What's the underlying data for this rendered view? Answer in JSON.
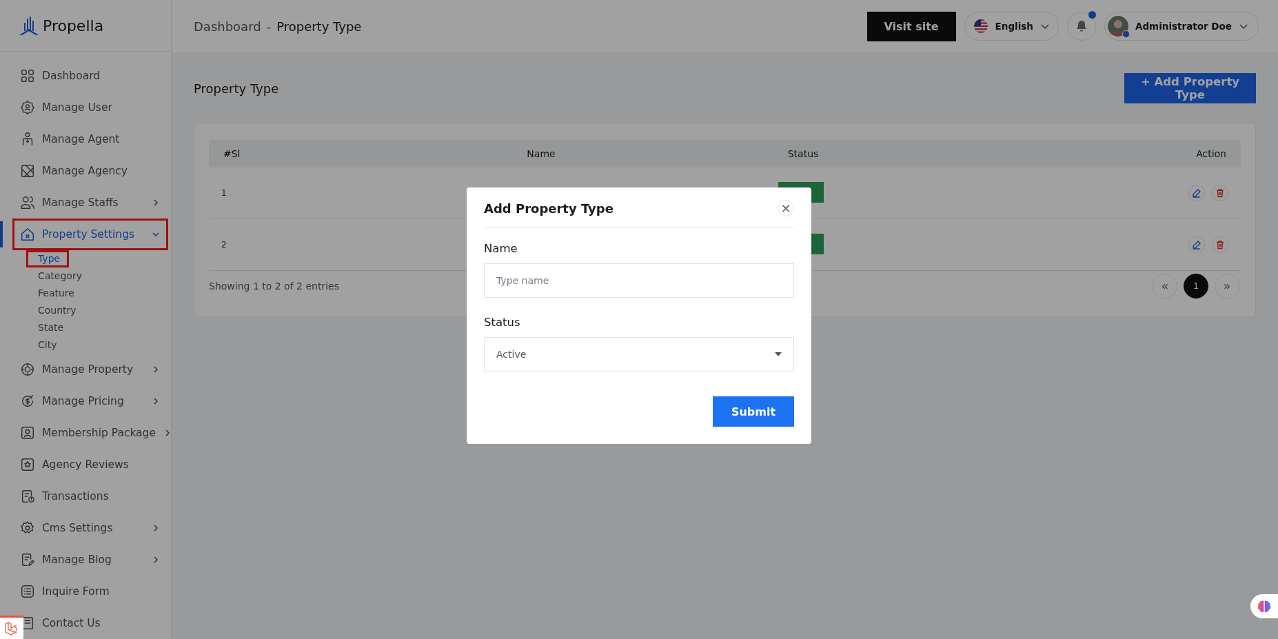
{
  "brand": {
    "name": "Propella"
  },
  "sidebar": {
    "items": [
      {
        "label": "Dashboard",
        "selected": false,
        "highlighted": false
      },
      {
        "label": "Manage User",
        "selected": false,
        "highlighted": false
      },
      {
        "label": "Manage Agent",
        "selected": false,
        "highlighted": false
      },
      {
        "label": "Manage Agency",
        "selected": false,
        "highlighted": false
      },
      {
        "label": "Manage Staffs",
        "selected": false,
        "highlighted": false,
        "expanded": false
      },
      {
        "label": "Property Settings",
        "selected": true,
        "highlighted": true,
        "expanded": true,
        "children": [
          {
            "label": "Type",
            "selected": true,
            "highlighted": true
          },
          {
            "label": "Category",
            "selected": false,
            "highlighted": false
          },
          {
            "label": "Feature",
            "selected": false,
            "highlighted": false
          },
          {
            "label": "Country",
            "selected": false,
            "highlighted": false
          },
          {
            "label": "State",
            "selected": false,
            "highlighted": false
          },
          {
            "label": "City",
            "selected": false,
            "highlighted": false
          }
        ]
      },
      {
        "label": "Manage Property",
        "selected": false,
        "highlighted": false,
        "expanded": false
      },
      {
        "label": "Manage Pricing",
        "selected": false,
        "highlighted": false,
        "expanded": false
      },
      {
        "label": "Membership Package",
        "selected": false,
        "highlighted": false,
        "expanded": false
      },
      {
        "label": "Agency Reviews",
        "selected": false,
        "highlighted": false
      },
      {
        "label": "Transactions",
        "selected": false,
        "highlighted": false
      },
      {
        "label": "Cms Settings",
        "selected": false,
        "highlighted": false,
        "expanded": false
      },
      {
        "label": "Manage Blog",
        "selected": false,
        "highlighted": false,
        "expanded": false
      },
      {
        "label": "Inquire Form",
        "selected": false,
        "highlighted": false
      },
      {
        "label": "Contact Us",
        "selected": false,
        "highlighted": false
      }
    ]
  },
  "header": {
    "breadcrumb": [
      "Dashboard",
      "-",
      "Property Type"
    ],
    "visit_button": "Visit site",
    "language": "English",
    "notifications": {
      "unread": true
    },
    "user": {
      "name": "Administrator Doe",
      "online": true
    }
  },
  "page": {
    "title": "Property Type",
    "add_button": "+ Add Property Type"
  },
  "table": {
    "columns": [
      "#Sl",
      "Name",
      "Status",
      "Action"
    ],
    "rows": [
      {
        "sl": "1"
      },
      {
        "sl": "2"
      }
    ],
    "footer": "Showing 1 to 2 of 2 entries",
    "pagination": [
      {
        "label": "«",
        "kind": "prev",
        "selected": false
      },
      {
        "label": "1",
        "kind": "page",
        "selected": true
      },
      {
        "label": "»",
        "kind": "next",
        "selected": false
      }
    ]
  },
  "modal": {
    "title": "Add Property Type",
    "close": "×",
    "fields": [
      {
        "kind": "text",
        "label": "Name",
        "placeholder": "Type name"
      },
      {
        "kind": "select",
        "label": "Status",
        "value": "Active"
      }
    ],
    "submit": "Submit"
  }
}
